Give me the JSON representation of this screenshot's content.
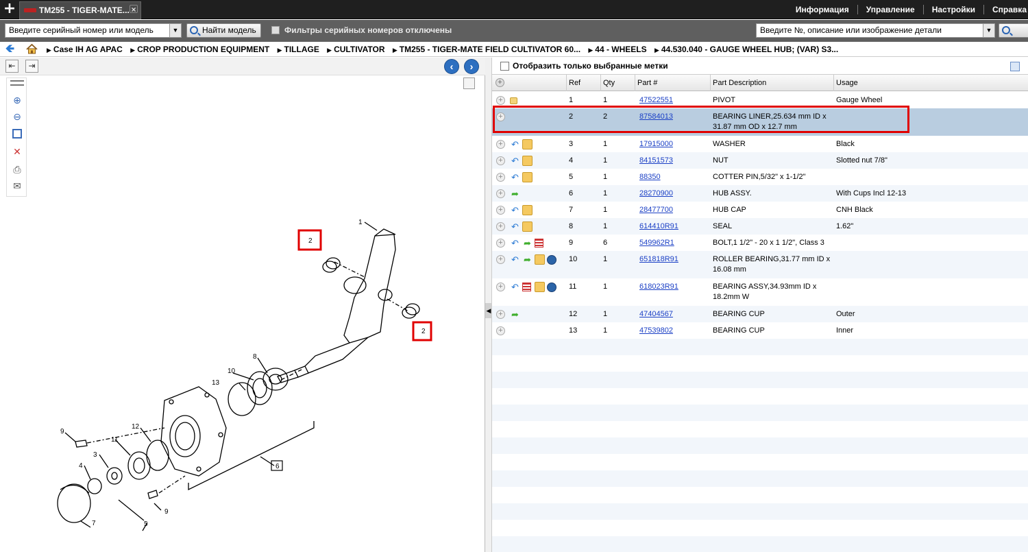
{
  "topbar": {
    "tab_title": "TM255 - TIGER-MATE...",
    "menu": [
      "Информация",
      "Управление",
      "Настройки",
      "Справка"
    ]
  },
  "searchbar": {
    "serial_placeholder": "Введите серийный номер или модель",
    "find_model_label": "Найти модель",
    "filters_label": "Фильтры серийных номеров отключены",
    "part_search_placeholder": "Введите №, описание или изображение детали"
  },
  "breadcrumb": [
    "Case IH AG APAC",
    "CROP PRODUCTION EQUIPMENT",
    "TILLAGE",
    "CULTIVATOR",
    "TM255 - TIGER-MATE FIELD CULTIVATOR 60...",
    "44 - WHEELS",
    "44.530.040 - GAUGE WHEEL HUB; (VAR) S3..."
  ],
  "right_panel": {
    "show_selected_label": "Отобразить только выбранные метки",
    "columns": {
      "ref": "Ref",
      "qty": "Qty",
      "part": "Part #",
      "desc": "Part Description",
      "usage": "Usage"
    },
    "rows": [
      {
        "ref": "1",
        "qty": "1",
        "part": "47522551",
        "desc1": "PIVOT",
        "desc2": "",
        "usage": "Gauge Wheel",
        "icons": [
          "note"
        ]
      },
      {
        "ref": "2",
        "qty": "2",
        "part": "87584013",
        "desc1": "BEARING LINER,25.634 mm ID x",
        "desc2": "31.87 mm OD x 12.7 mm",
        "usage": "",
        "icons": []
      },
      {
        "ref": "3",
        "qty": "1",
        "part": "17915000",
        "desc1": "WASHER",
        "desc2": "",
        "usage": "Black",
        "icons": [
          "back",
          "box"
        ]
      },
      {
        "ref": "4",
        "qty": "1",
        "part": "84151573",
        "desc1": "NUT",
        "desc2": "",
        "usage": "Slotted nut 7/8\"",
        "icons": [
          "back",
          "box"
        ]
      },
      {
        "ref": "5",
        "qty": "1",
        "part": "88350",
        "desc1": "COTTER PIN,5/32\" x 1-1/2\"",
        "desc2": "",
        "usage": "",
        "icons": [
          "back",
          "box"
        ]
      },
      {
        "ref": "6",
        "qty": "1",
        "part": "28270900",
        "desc1": "HUB ASSY.",
        "desc2": "",
        "usage": "With Cups Incl 12-13",
        "icons": [
          "fwd"
        ]
      },
      {
        "ref": "7",
        "qty": "1",
        "part": "28477700",
        "desc1": "HUB CAP",
        "desc2": "",
        "usage": "CNH Black",
        "icons": [
          "back",
          "box"
        ]
      },
      {
        "ref": "8",
        "qty": "1",
        "part": "614410R91",
        "desc1": "SEAL",
        "desc2": "",
        "usage": "1.62\"",
        "icons": [
          "back",
          "box"
        ]
      },
      {
        "ref": "9",
        "qty": "6",
        "part": "549962R1",
        "desc1": "BOLT,1 1/2\" - 20 x 1 1/2\", Class 3",
        "desc2": "",
        "usage": "",
        "icons": [
          "back",
          "fwd",
          "list"
        ]
      },
      {
        "ref": "10",
        "qty": "1",
        "part": "651818R91",
        "desc1": "ROLLER BEARING,31.77 mm ID x",
        "desc2": "16.08 mm",
        "usage": "",
        "icons": [
          "back",
          "fwd",
          "box",
          "globe"
        ]
      },
      {
        "ref": "11",
        "qty": "1",
        "part": "618023R91",
        "desc1": "BEARING ASSY,34.93mm ID x",
        "desc2": "18.2mm W",
        "usage": "",
        "icons": [
          "back",
          "list",
          "box",
          "globe"
        ]
      },
      {
        "ref": "12",
        "qty": "1",
        "part": "47404567",
        "desc1": "BEARING CUP",
        "desc2": "",
        "usage": "Outer",
        "icons": [
          "fwd"
        ]
      },
      {
        "ref": "13",
        "qty": "1",
        "part": "47539802",
        "desc1": "BEARING CUP",
        "desc2": "",
        "usage": "Inner",
        "icons": []
      }
    ]
  },
  "diagram": {
    "callouts": [
      "1",
      "2",
      "2",
      "3",
      "4",
      "5",
      "6",
      "7",
      "8",
      "9",
      "9",
      "10",
      "11",
      "12",
      "13"
    ]
  },
  "colors": {
    "selected_row": "#b9cde0",
    "highlight": "#e00000",
    "link": "#1a3fc5"
  }
}
